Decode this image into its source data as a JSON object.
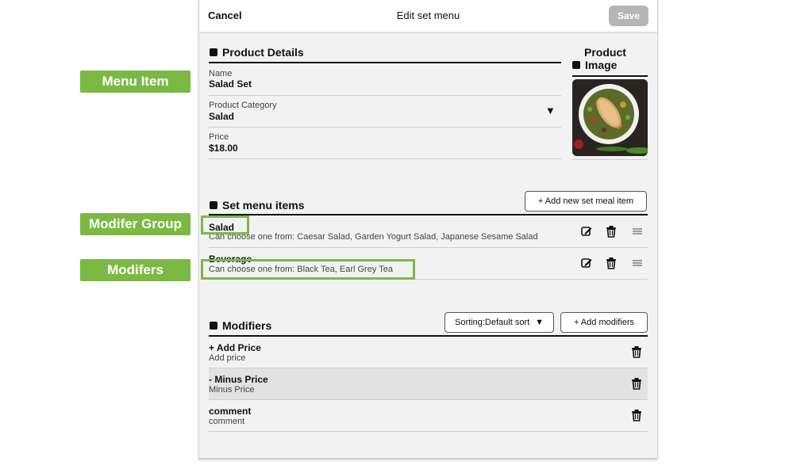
{
  "annotations": {
    "menu_item": "Menu Item",
    "modifier_group": "Modifer Group",
    "modifiers": "Modifers"
  },
  "topbar": {
    "cancel": "Cancel",
    "title": "Edit set menu",
    "save": "Save"
  },
  "product_details": {
    "heading": "Product Details",
    "name_label": "Name",
    "name_value": "Salad Set",
    "category_label": "Product Category",
    "category_value": "Salad",
    "price_label": "Price",
    "price_value": "$18.00"
  },
  "product_image": {
    "heading_line1": "Product",
    "heading_line2": "Image"
  },
  "set_menu": {
    "heading": "Set menu items",
    "add_button": "+  Add new set meal item",
    "items": [
      {
        "title": "Salad",
        "sub": "Can choose one from: Caesar Salad, Garden Yogurt Salad, Japanese Sesame Salad"
      },
      {
        "title": "Beverage",
        "sub": "Can choose one from: Black Tea, Earl Grey Tea"
      }
    ]
  },
  "modifiers": {
    "heading": "Modifiers",
    "sorting": "Sorting:Default sort",
    "add_button": "+  Add modifiers",
    "items": [
      {
        "title": "+ Add Price",
        "sub": "Add price"
      },
      {
        "title": "- Minus Price",
        "sub": "Minus Price"
      },
      {
        "title": "comment",
        "sub": "comment"
      }
    ]
  },
  "colors": {
    "accent": "#7cb944",
    "save_disabled": "#b5b5b5",
    "panel_bg": "#f2f2f2"
  },
  "icons": [
    "edit-icon",
    "trash-icon",
    "drag-handle-icon",
    "chevron-down-icon"
  ]
}
